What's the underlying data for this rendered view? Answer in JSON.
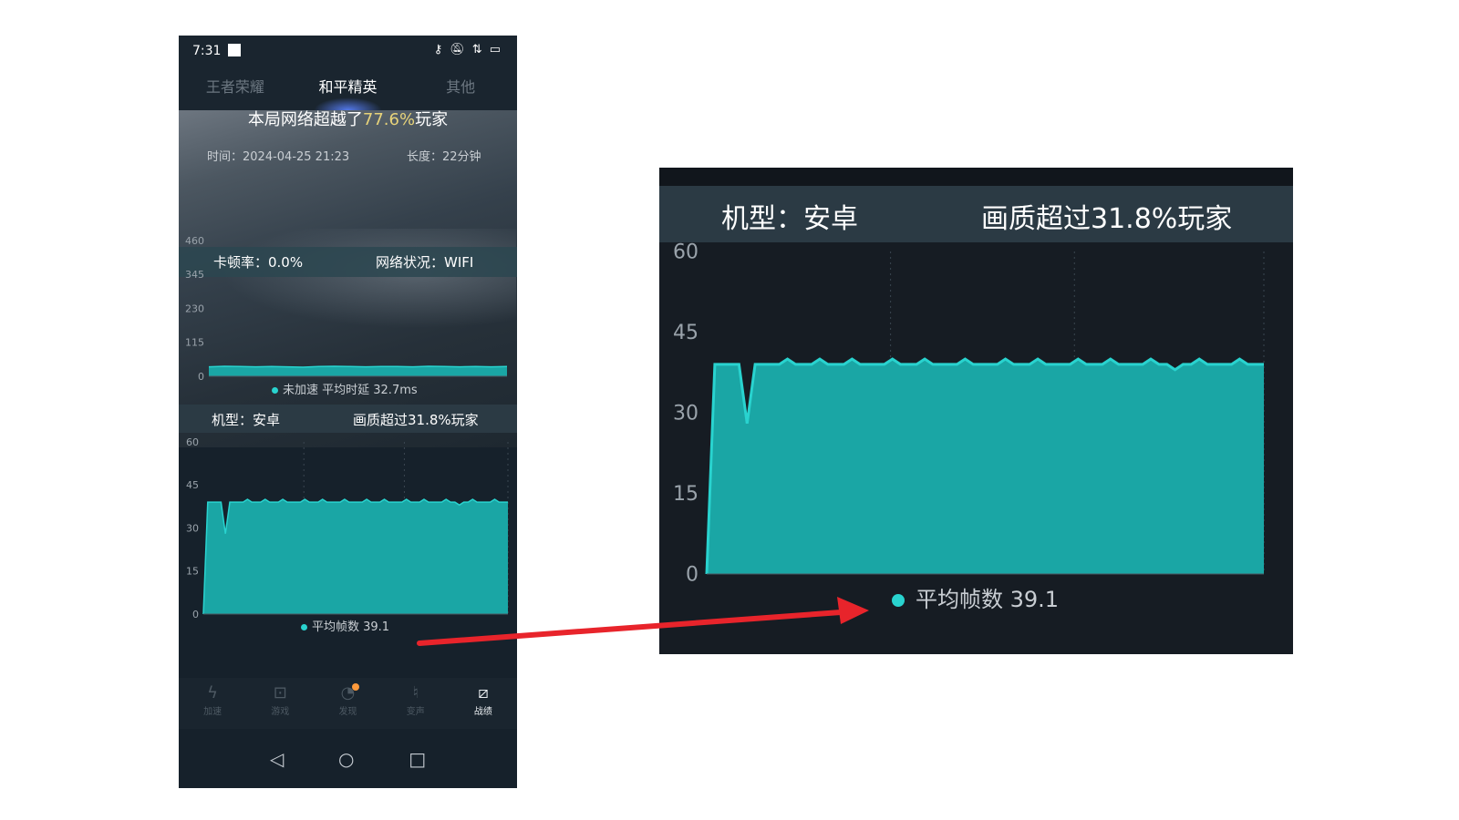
{
  "status_bar": {
    "time": "7:31",
    "icons": [
      "key-icon",
      "mute-icon",
      "wifi-icon",
      "battery-icon"
    ]
  },
  "tabs": [
    {
      "label": "王者荣耀",
      "active": false
    },
    {
      "label": "和平精英",
      "active": true
    },
    {
      "label": "其他",
      "active": false
    }
  ],
  "summary": {
    "title_prefix": "本局网络超越了",
    "title_percent": "77.6%",
    "title_suffix": "玩家",
    "time_text": "时间：2024-04-25 21:23",
    "length_text": "长度：22分钟",
    "stutter_text": "卡顿率：0.0%",
    "network_text": "网络状况：WIFI"
  },
  "device": {
    "model_text": "机型：安卓",
    "quality_text": "画质超过31.8%玩家"
  },
  "colors": {
    "series": "#1aa6a5",
    "series_line": "#29d3cf",
    "highlight": "#e7d37a",
    "arrow": "#e8242b"
  },
  "chart_data": [
    {
      "type": "area",
      "y_ticks": [
        "460",
        "345",
        "230",
        "115",
        "0"
      ],
      "ylim": [
        0,
        460
      ],
      "legend": "未加速 平均时延 32.7ms",
      "series": [
        {
          "values": [
            32,
            34,
            33,
            32,
            33,
            32,
            31,
            33,
            34,
            33,
            32,
            33,
            33,
            32,
            34,
            33,
            32,
            33,
            32,
            33
          ]
        }
      ]
    },
    {
      "type": "area",
      "y_ticks": [
        "60",
        "45",
        "30",
        "15",
        "0"
      ],
      "ylim": [
        0,
        60
      ],
      "legend": "平均帧数 39.1",
      "series": [
        {
          "values": [
            0,
            39,
            39,
            39,
            39,
            28,
            39,
            39,
            39,
            39,
            40,
            39,
            39,
            39,
            40,
            39,
            39,
            39,
            40,
            39,
            39,
            39,
            39,
            40,
            39,
            39,
            39,
            40,
            39,
            39,
            39,
            39,
            40,
            39,
            39,
            39,
            39,
            40,
            39,
            39,
            39,
            40,
            39,
            39,
            39,
            39,
            40,
            39,
            39,
            39,
            40,
            39,
            39,
            39,
            39,
            40,
            39,
            39,
            38,
            39,
            39,
            40,
            39,
            39,
            39,
            39,
            40,
            39,
            39,
            39
          ]
        }
      ]
    }
  ],
  "bottom_nav": [
    {
      "label": "加速",
      "icon": "lightning-icon",
      "active": false
    },
    {
      "label": "游戏",
      "icon": "gamepad-icon",
      "active": false
    },
    {
      "label": "发现",
      "icon": "discover-icon",
      "active": false
    },
    {
      "label": "变声",
      "icon": "microphone-icon",
      "active": false
    },
    {
      "label": "战绩",
      "icon": "stats-icon",
      "active": true
    }
  ],
  "system_nav": [
    "back-icon",
    "home-icon",
    "recents-icon"
  ]
}
